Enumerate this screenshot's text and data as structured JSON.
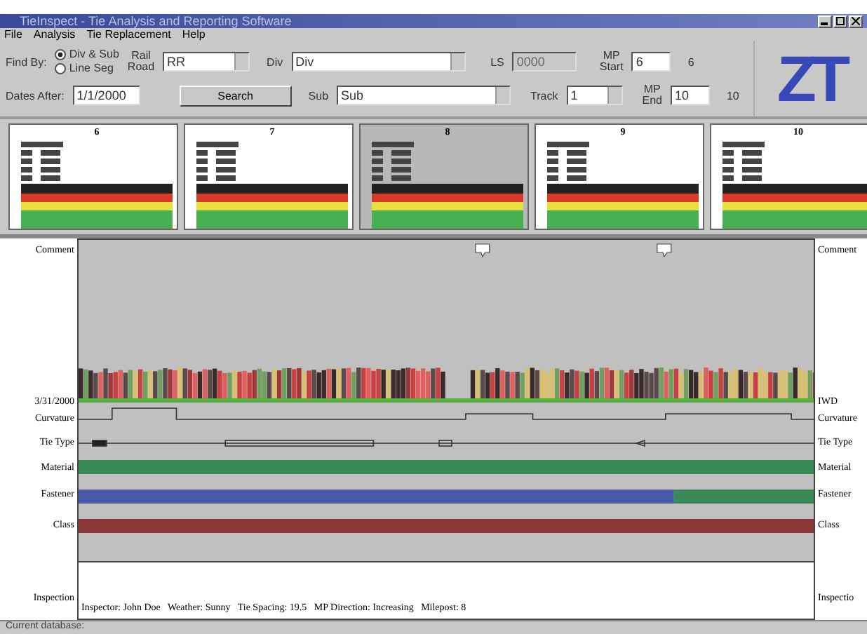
{
  "window": {
    "title": "TieInspect - Tie Analysis and Reporting Software"
  },
  "menu": [
    {
      "label": "File"
    },
    {
      "label": "Analysis"
    },
    {
      "label": "Tie Replacement"
    },
    {
      "label": "Help"
    }
  ],
  "search": {
    "find_by_label": "Find By:",
    "find_by_options": [
      {
        "label": "Div & Sub",
        "selected": true
      },
      {
        "label": "Line Seg",
        "selected": false
      }
    ],
    "railroad_label": "Rail Road",
    "railroad": "RR",
    "div_label": "Div",
    "div": "Div",
    "ls_label": "LS",
    "ls": "0000",
    "mp_start_label": "MP Start",
    "mp_start": "6",
    "mp_start_note": "6",
    "dates_label": "Dates After:",
    "dates": "1/1/2000",
    "search_button": "Search",
    "sub_label": "Sub",
    "sub": "Sub",
    "track_label": "Track",
    "track": "1",
    "mp_end_label": "MP End",
    "mp_end": "10",
    "mp_end_note": "10"
  },
  "logo": "ZT",
  "cards": [
    {
      "number": "6",
      "selected": false
    },
    {
      "number": "7",
      "selected": false
    },
    {
      "number": "8",
      "selected": true
    },
    {
      "number": "9",
      "selected": false
    },
    {
      "number": "10",
      "selected": false
    }
  ],
  "track_chart": {
    "left_labels": [
      "Comment",
      "3/31/2000",
      "Curvature",
      "Tie Type",
      "Material",
      "Fastener",
      "Class",
      "Inspection"
    ],
    "right_labels": [
      "Comment",
      "IWD",
      "Curvature",
      "Tie Type",
      "Material",
      "Fastener",
      "Class",
      "Inspectio"
    ],
    "inspection_info": "Inspector: John Doe   Weather: Sunny   Tie Spacing: 19.5   MP Direction: Increasing   Milepost: 8"
  },
  "status_bar": "Current database:"
}
